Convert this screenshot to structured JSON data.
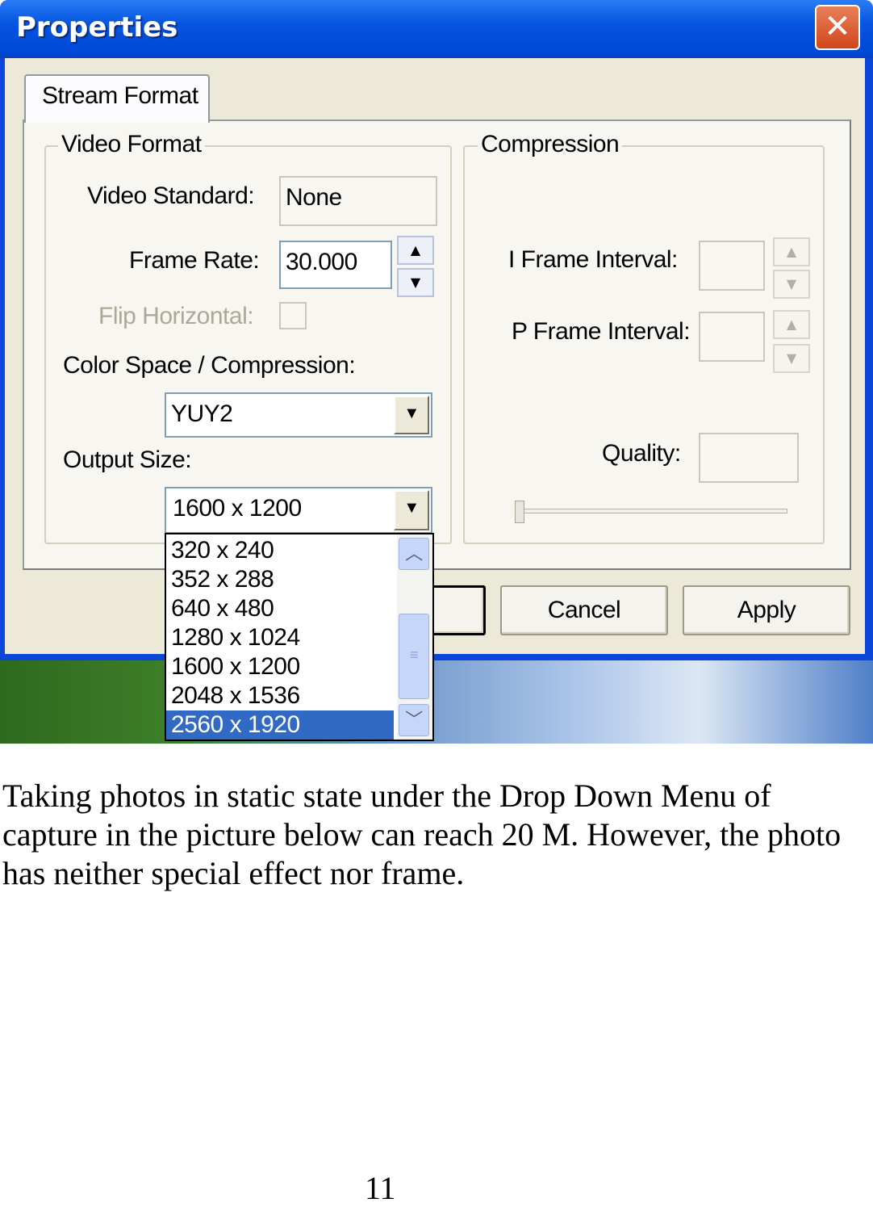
{
  "dialog": {
    "title": "Properties",
    "close_icon": "close-icon",
    "tab": "Stream Format",
    "video_format": {
      "group_label": "Video Format",
      "video_standard_label": "Video Standard:",
      "video_standard_value": "None",
      "frame_rate_label": "Frame Rate:",
      "frame_rate_value": "30.000",
      "flip_horizontal_label": "Flip Horizontal:",
      "flip_horizontal_checked": false,
      "color_space_label": "Color Space / Compression:",
      "color_space_value": "YUY2",
      "output_size_label": "Output Size:",
      "output_size_value": "1600 x 1200",
      "output_size_options": [
        "320 x 240",
        "352 x 288",
        "640 x 480",
        "1280 x 1024",
        "1600 x 1200",
        "2048 x 1536",
        "2560 x 1920"
      ],
      "highlighted_option": "2560 x 1920"
    },
    "compression": {
      "group_label": "Compression",
      "i_frame_label": "I Frame Interval:",
      "p_frame_label": "P Frame Interval:",
      "quality_label": "Quality:"
    },
    "buttons": {
      "cancel": "Cancel",
      "apply": "Apply"
    },
    "selection_color": "#316ac5"
  },
  "document": {
    "paragraph": "Taking photos in static state under the Drop Down Menu of capture in the picture below can reach 20 M. However, the photo has neither special effect nor frame.",
    "page_number": "11"
  }
}
